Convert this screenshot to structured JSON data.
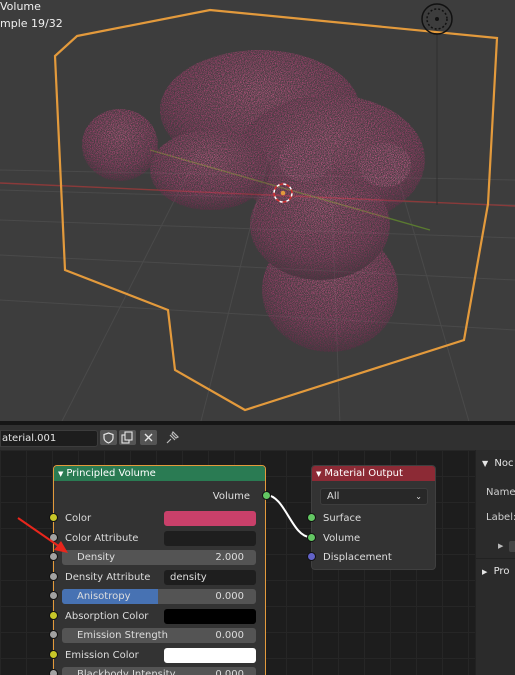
{
  "viewport": {
    "render_mode": "Volume",
    "sample_text": "mple 19/32"
  },
  "node_editor": {
    "material_name": "aterial.001",
    "nodes": {
      "principled": {
        "title": "Principled Volume",
        "output_label": "Volume",
        "inputs": [
          {
            "label": "Color",
            "kind": "color",
            "color": "#c9406a"
          },
          {
            "label": "Color Attribute",
            "kind": "text",
            "value": ""
          },
          {
            "label": "Density",
            "kind": "number",
            "value": "2.000"
          },
          {
            "label": "Density Attribute",
            "kind": "text",
            "value": "density"
          },
          {
            "label": "Anisotropy",
            "kind": "slider",
            "value": "0.000"
          },
          {
            "label": "Absorption Color",
            "kind": "color",
            "color": "#000000"
          },
          {
            "label": "Emission Strength",
            "kind": "number",
            "value": "0.000"
          },
          {
            "label": "Emission Color",
            "kind": "color",
            "color": "#ffffff"
          },
          {
            "label": "Blackbody Intensity",
            "kind": "number",
            "value": "0.000"
          }
        ]
      },
      "output": {
        "title": "Material Output",
        "target": "All",
        "inputs": [
          "Surface",
          "Volume",
          "Displacement"
        ]
      }
    }
  },
  "side_panel": {
    "tab": "Noc",
    "name_label": "Name",
    "label_label": "Label:",
    "section2": "Pro"
  },
  "colors": {
    "principled_header": "#2a7b53",
    "output_header": "#8c2a35",
    "selection_outline": "#e39a3c",
    "shader_socket": "#63c763",
    "color_socket": "#c7c729",
    "value_socket": "#a1a1a1",
    "vector_socket": "#6363c7"
  }
}
